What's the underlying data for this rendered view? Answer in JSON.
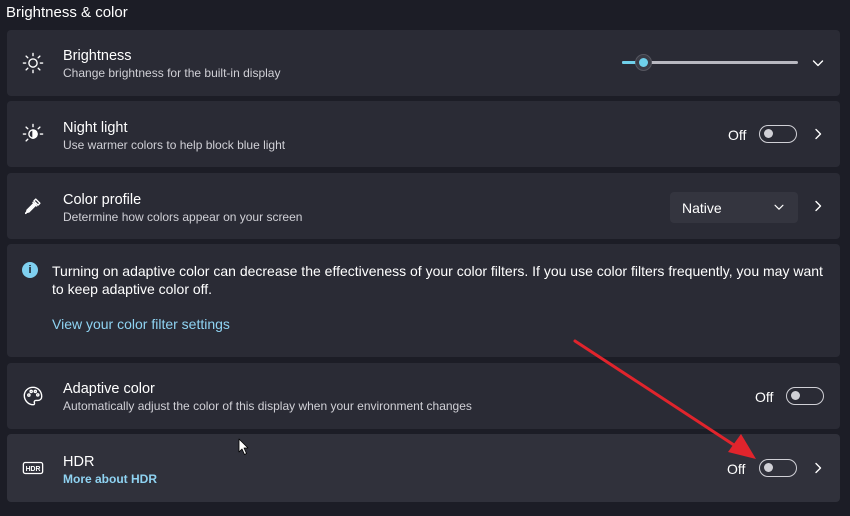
{
  "section_title": "Brightness & color",
  "brightness": {
    "title": "Brightness",
    "subtitle": "Change brightness for the built-in display",
    "level": 0.12,
    "accent": "#6fd0ea",
    "icon": "sun-icon"
  },
  "night_light": {
    "title": "Night light",
    "subtitle": "Use warmer colors to help block blue light",
    "state": "Off",
    "icon": "night-light-icon"
  },
  "color_profile": {
    "title": "Color profile",
    "subtitle": "Determine how colors appear on your screen",
    "selected": "Native",
    "icon": "eyedropper-icon"
  },
  "info": {
    "text": "Turning on adaptive color can decrease the effectiveness of your color filters. If you use color filters frequently, you may want to keep adaptive color off.",
    "link": "View your color filter settings",
    "icon": "info-icon"
  },
  "adaptive_color": {
    "title": "Adaptive color",
    "subtitle": "Automatically adjust the color of this display when your environment changes",
    "state": "Off",
    "icon": "palette-icon"
  },
  "hdr": {
    "title": "HDR",
    "link": "More about HDR",
    "state": "Off",
    "icon": "hdr-icon"
  },
  "annotation_color": "#e0242c"
}
